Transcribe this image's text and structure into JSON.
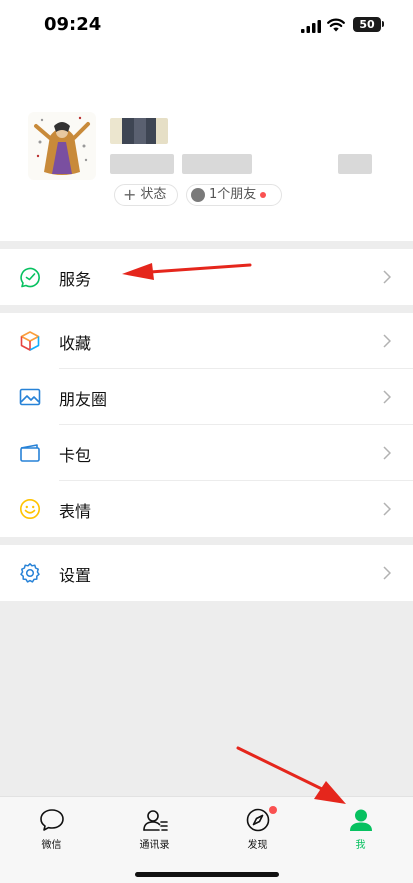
{
  "status_bar": {
    "time": "09:24",
    "battery": "50"
  },
  "profile": {
    "status_chip": "状态",
    "friends_chip": "1个朋友"
  },
  "menu": {
    "services": "服务",
    "favorites": "收藏",
    "moments": "朋友圈",
    "cards": "卡包",
    "stickers": "表情",
    "settings": "设置"
  },
  "tabbar": {
    "tabs": [
      {
        "label": "微信",
        "icon": "chat-bubble-icon"
      },
      {
        "label": "通讯录",
        "icon": "contacts-icon"
      },
      {
        "label": "发现",
        "icon": "compass-icon"
      },
      {
        "label": "我",
        "icon": "person-icon"
      }
    ],
    "active_index": 3
  },
  "colors": {
    "accent": "#07c160",
    "badge": "#fa5151",
    "annotation_arrow": "#e5261c"
  }
}
